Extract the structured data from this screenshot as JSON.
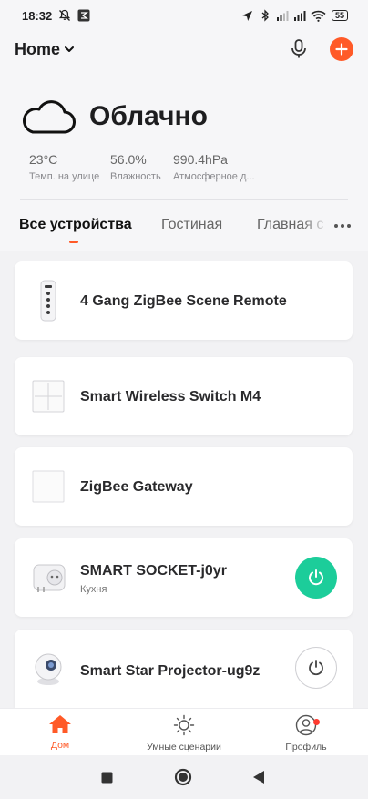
{
  "status_bar": {
    "time": "18:32",
    "battery": "55",
    "icons": [
      "notifications-off-icon",
      "app-s-icon",
      "location-icon",
      "bluetooth-icon",
      "signal-icon",
      "signal-icon",
      "wifi-icon",
      "battery-icon"
    ]
  },
  "header": {
    "home_label": "Home",
    "mic_icon": "microphone-icon",
    "add_icon": "plus-icon",
    "accent": "#ff5a28"
  },
  "weather": {
    "icon": "cloud-icon",
    "condition": "Облачно",
    "stats": [
      {
        "value": "23°C",
        "label": "Темп. на улице"
      },
      {
        "value": "56.0%",
        "label": "Влажность"
      },
      {
        "value": "990.4hPa",
        "label": "Атмосферное д..."
      }
    ]
  },
  "tabs": {
    "items": [
      "Все устройства",
      "Гостиная",
      "Главная с"
    ],
    "active_index": 0,
    "more_icon": "more-dots-icon"
  },
  "devices": [
    {
      "name": "4 Gang ZigBee Scene Remote",
      "room": "",
      "thumb": "remote-icon",
      "power": null
    },
    {
      "name": "Smart Wireless Switch M4",
      "room": "",
      "thumb": "switch-panel-icon",
      "power": null
    },
    {
      "name": "ZigBee Gateway",
      "room": "",
      "thumb": "gateway-icon",
      "power": null
    },
    {
      "name": "SMART SOCKET-j0yr",
      "room": "Кухня",
      "thumb": "socket-icon",
      "power": "on"
    },
    {
      "name": "Smart Star Projector-ug9z",
      "room": "",
      "thumb": "projector-icon",
      "power": "off"
    }
  ],
  "bottom_nav": [
    {
      "label": "Дом",
      "icon": "home-icon",
      "active": true
    },
    {
      "label": "Умные сценарии",
      "icon": "sun-icon",
      "active": false
    },
    {
      "label": "Профиль",
      "icon": "profile-icon",
      "active": false,
      "badge": true
    }
  ],
  "colors": {
    "accent": "#ff5a28",
    "power_on": "#1ccd9a",
    "badge": "#ff3b30"
  }
}
